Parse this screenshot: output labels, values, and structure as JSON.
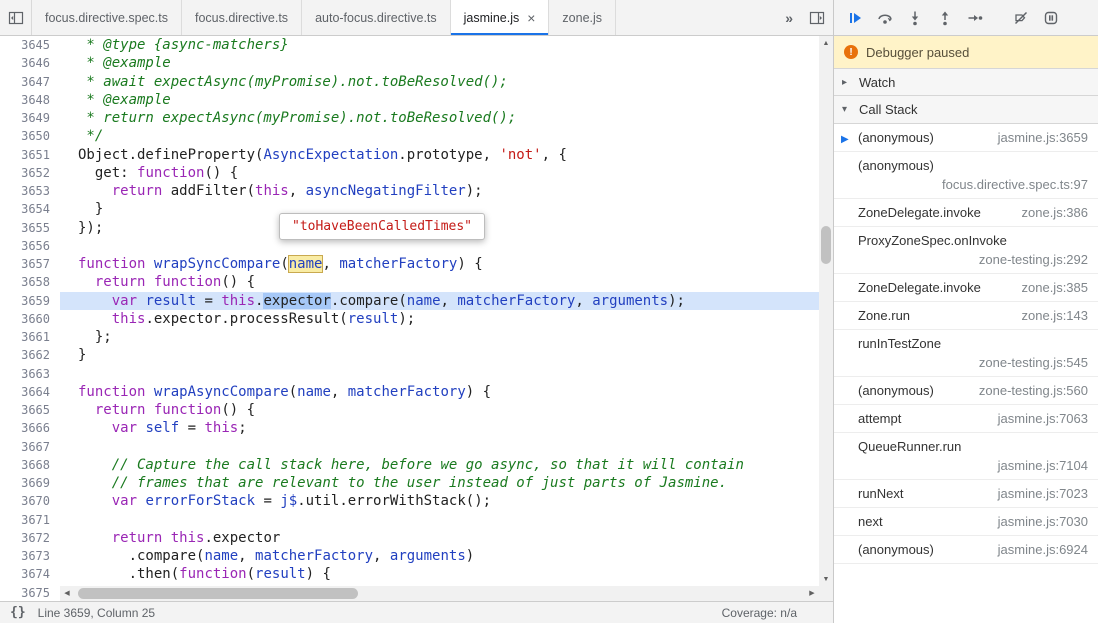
{
  "colors": {
    "accent": "#1a73e8",
    "paused_banner_bg": "#fff3c8",
    "exec_line_bg": "#d4e4fb",
    "keyword": "#9a26b5",
    "variable": "#2240c0",
    "string": "#c41a16",
    "comment": "#1a7a1f"
  },
  "icons": {
    "tabbar": [
      "navigator-toggle-icon",
      "debugger-sidebar-toggle-icon",
      "tab-close-icon"
    ],
    "debug_toolbar": [
      "resume-icon",
      "step-over-icon",
      "step-into-icon",
      "step-out-icon",
      "step-icon",
      "deactivate-breakpoints-icon",
      "pause-on-exceptions-icon"
    ],
    "status": [
      "pretty-print-braces-icon"
    ],
    "banner": [
      "paused-info-icon"
    ]
  },
  "tabs": {
    "overflow": "»",
    "items": [
      {
        "label": "focus.directive.spec.ts",
        "active": false
      },
      {
        "label": "focus.directive.ts",
        "active": false
      },
      {
        "label": "auto-focus.directive.ts",
        "active": false
      },
      {
        "label": "jasmine.js",
        "active": true,
        "close": "×"
      },
      {
        "label": "zone.js",
        "active": false
      }
    ]
  },
  "banner": {
    "text": "Debugger paused",
    "icon_glyph": "!"
  },
  "sidebar": {
    "watch": {
      "title": "Watch",
      "collapsed_glyph": "▸"
    },
    "call_stack": {
      "title": "Call Stack",
      "expanded_glyph": "▾",
      "current_arrow_glyph": "▶",
      "frames": [
        {
          "name": "(anonymous)",
          "location": "jasmine.js:3659",
          "current": true
        },
        {
          "name": "(anonymous)",
          "location": "focus.directive.spec.ts:97",
          "current": false
        },
        {
          "name": "ZoneDelegate.invoke",
          "location": "zone.js:386",
          "current": false
        },
        {
          "name": "ProxyZoneSpec.onInvoke",
          "location": "zone-testing.js:292",
          "current": false
        },
        {
          "name": "ZoneDelegate.invoke",
          "location": "zone.js:385",
          "current": false
        },
        {
          "name": "Zone.run",
          "location": "zone.js:143",
          "current": false
        },
        {
          "name": "runInTestZone",
          "location": "zone-testing.js:545",
          "current": false
        },
        {
          "name": "(anonymous)",
          "location": "zone-testing.js:560",
          "current": false
        },
        {
          "name": "attempt",
          "location": "jasmine.js:7063",
          "current": false
        },
        {
          "name": "QueueRunner.run",
          "location": "jasmine.js:7104",
          "current": false
        },
        {
          "name": "runNext",
          "location": "jasmine.js:7023",
          "current": false
        },
        {
          "name": "next",
          "location": "jasmine.js:7030",
          "current": false
        },
        {
          "name": "(anonymous)",
          "location": "jasmine.js:6924",
          "current": false
        }
      ]
    }
  },
  "editor": {
    "current_line": 3659,
    "tooltip": {
      "value": "\"toHaveBeenCalledTimes\""
    },
    "lines": [
      {
        "n": 3645,
        "s": [
          [
            "c",
            " * @type {async-matchers}"
          ]
        ]
      },
      {
        "n": 3646,
        "s": [
          [
            "c",
            " * @example"
          ]
        ]
      },
      {
        "n": 3647,
        "s": [
          [
            "c",
            " * await expectAsync(myPromise).not.toBeResolved();"
          ]
        ]
      },
      {
        "n": 3648,
        "s": [
          [
            "c",
            " * @example"
          ]
        ]
      },
      {
        "n": 3649,
        "s": [
          [
            "c",
            " * return expectAsync(myPromise).not.toBeResolved();"
          ]
        ]
      },
      {
        "n": 3650,
        "s": [
          [
            "c",
            " */"
          ]
        ]
      },
      {
        "n": 3651,
        "s": [
          [
            "p",
            "Object.defineProperty("
          ],
          [
            "v",
            "AsyncExpectation"
          ],
          [
            "p",
            ".prototype, "
          ],
          [
            "s",
            "'not'"
          ],
          [
            "p",
            ", {"
          ]
        ]
      },
      {
        "n": 3652,
        "s": [
          [
            "p",
            "  get: "
          ],
          [
            "k",
            "function"
          ],
          [
            "p",
            "() {"
          ]
        ]
      },
      {
        "n": 3653,
        "s": [
          [
            "p",
            "    "
          ],
          [
            "k",
            "return"
          ],
          [
            "p",
            " addFilter("
          ],
          [
            "k",
            "this"
          ],
          [
            "p",
            ", "
          ],
          [
            "v",
            "asyncNegatingFilter"
          ],
          [
            "p",
            ");"
          ]
        ]
      },
      {
        "n": 3654,
        "s": [
          [
            "p",
            "  }"
          ]
        ]
      },
      {
        "n": 3655,
        "s": [
          [
            "p",
            "});"
          ]
        ]
      },
      {
        "n": 3656,
        "s": []
      },
      {
        "n": 3657,
        "s": [
          [
            "k",
            "function"
          ],
          [
            "p",
            " "
          ],
          [
            "v",
            "wrapSyncCompare"
          ],
          [
            "p",
            "("
          ],
          [
            "e",
            "name"
          ],
          [
            "p",
            ", "
          ],
          [
            "v",
            "matcherFactory"
          ],
          [
            "p",
            ") {"
          ]
        ]
      },
      {
        "n": 3658,
        "s": [
          [
            "p",
            "  "
          ],
          [
            "k",
            "return"
          ],
          [
            "p",
            " "
          ],
          [
            "k",
            "function"
          ],
          [
            "p",
            "() {"
          ]
        ]
      },
      {
        "n": 3659,
        "s": [
          [
            "p",
            "    "
          ],
          [
            "k",
            "var"
          ],
          [
            "p",
            " "
          ],
          [
            "v",
            "result"
          ],
          [
            "p",
            " = "
          ],
          [
            "k",
            "this"
          ],
          [
            "p",
            "."
          ],
          [
            "x",
            "expector"
          ],
          [
            "p",
            ".compare("
          ],
          [
            "v",
            "name"
          ],
          [
            "p",
            ", "
          ],
          [
            "v",
            "matcherFactory"
          ],
          [
            "p",
            ", "
          ],
          [
            "v",
            "arguments"
          ],
          [
            "p",
            ");"
          ]
        ]
      },
      {
        "n": 3660,
        "s": [
          [
            "p",
            "    "
          ],
          [
            "k",
            "this"
          ],
          [
            "p",
            ".expector.processResult("
          ],
          [
            "v",
            "result"
          ],
          [
            "p",
            ");"
          ]
        ]
      },
      {
        "n": 3661,
        "s": [
          [
            "p",
            "  };"
          ]
        ]
      },
      {
        "n": 3662,
        "s": [
          [
            "p",
            "}"
          ]
        ]
      },
      {
        "n": 3663,
        "s": []
      },
      {
        "n": 3664,
        "s": [
          [
            "k",
            "function"
          ],
          [
            "p",
            " "
          ],
          [
            "v",
            "wrapAsyncCompare"
          ],
          [
            "p",
            "("
          ],
          [
            "v",
            "name"
          ],
          [
            "p",
            ", "
          ],
          [
            "v",
            "matcherFactory"
          ],
          [
            "p",
            ") {"
          ]
        ]
      },
      {
        "n": 3665,
        "s": [
          [
            "p",
            "  "
          ],
          [
            "k",
            "return"
          ],
          [
            "p",
            " "
          ],
          [
            "k",
            "function"
          ],
          [
            "p",
            "() {"
          ]
        ]
      },
      {
        "n": 3666,
        "s": [
          [
            "p",
            "    "
          ],
          [
            "k",
            "var"
          ],
          [
            "p",
            " "
          ],
          [
            "v",
            "self"
          ],
          [
            "p",
            " = "
          ],
          [
            "k",
            "this"
          ],
          [
            "p",
            ";"
          ]
        ]
      },
      {
        "n": 3667,
        "s": []
      },
      {
        "n": 3668,
        "s": [
          [
            "p",
            "    "
          ],
          [
            "c",
            "// Capture the call stack here, before we go async, so that it will contain"
          ]
        ]
      },
      {
        "n": 3669,
        "s": [
          [
            "p",
            "    "
          ],
          [
            "c",
            "// frames that are relevant to the user instead of just parts of Jasmine."
          ]
        ]
      },
      {
        "n": 3670,
        "s": [
          [
            "p",
            "    "
          ],
          [
            "k",
            "var"
          ],
          [
            "p",
            " "
          ],
          [
            "v",
            "errorForStack"
          ],
          [
            "p",
            " = "
          ],
          [
            "v",
            "j$"
          ],
          [
            "p",
            ".util.errorWithStack();"
          ]
        ]
      },
      {
        "n": 3671,
        "s": []
      },
      {
        "n": 3672,
        "s": [
          [
            "p",
            "    "
          ],
          [
            "k",
            "return"
          ],
          [
            "p",
            " "
          ],
          [
            "k",
            "this"
          ],
          [
            "p",
            ".expector"
          ]
        ]
      },
      {
        "n": 3673,
        "s": [
          [
            "p",
            "      .compare("
          ],
          [
            "v",
            "name"
          ],
          [
            "p",
            ", "
          ],
          [
            "v",
            "matcherFactory"
          ],
          [
            "p",
            ", "
          ],
          [
            "v",
            "arguments"
          ],
          [
            "p",
            ")"
          ]
        ]
      },
      {
        "n": 3674,
        "s": [
          [
            "p",
            "      .then("
          ],
          [
            "k",
            "function"
          ],
          [
            "p",
            "("
          ],
          [
            "v",
            "result"
          ],
          [
            "p",
            ") {"
          ]
        ]
      },
      {
        "n": 3675,
        "s": []
      }
    ]
  },
  "status_bar": {
    "braces_glyph": "{}",
    "line_col": "Line 3659, Column 25",
    "coverage": "Coverage: n/a"
  }
}
